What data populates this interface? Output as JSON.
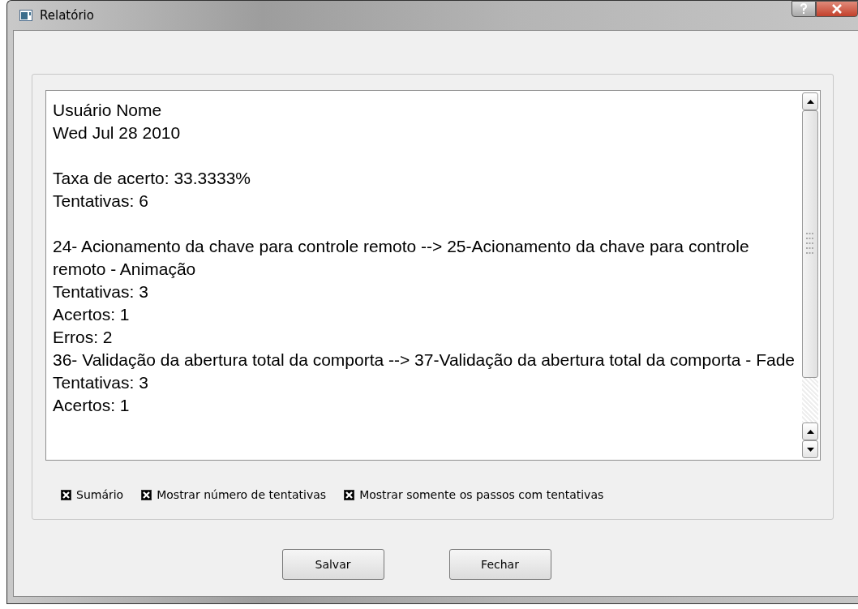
{
  "window": {
    "title": "Relatório"
  },
  "report": {
    "blocks": [
      [
        "Usuário Nome",
        "Wed Jul 28 2010"
      ],
      [
        "Taxa de acerto: 33.3333%",
        "Tentativas: 6"
      ],
      [
        "24- Acionamento da chave para controle remoto --> 25-Acionamento da chave para controle remoto - Animação",
        "Tentativas: 3",
        "Acertos: 1",
        "Erros: 2",
        "36- Validação da abertura total da comporta --> 37-Validação da abertura total da comporta - Fade",
        "Tentativas: 3",
        "Acertos: 1"
      ]
    ]
  },
  "options": [
    {
      "label": "Sumário",
      "checked": true
    },
    {
      "label": "Mostrar número de tentativas",
      "checked": true
    },
    {
      "label": "Mostrar somente os passos com tentativas",
      "checked": true
    }
  ],
  "buttons": [
    {
      "label": "Salvar"
    },
    {
      "label": "Fechar"
    }
  ]
}
